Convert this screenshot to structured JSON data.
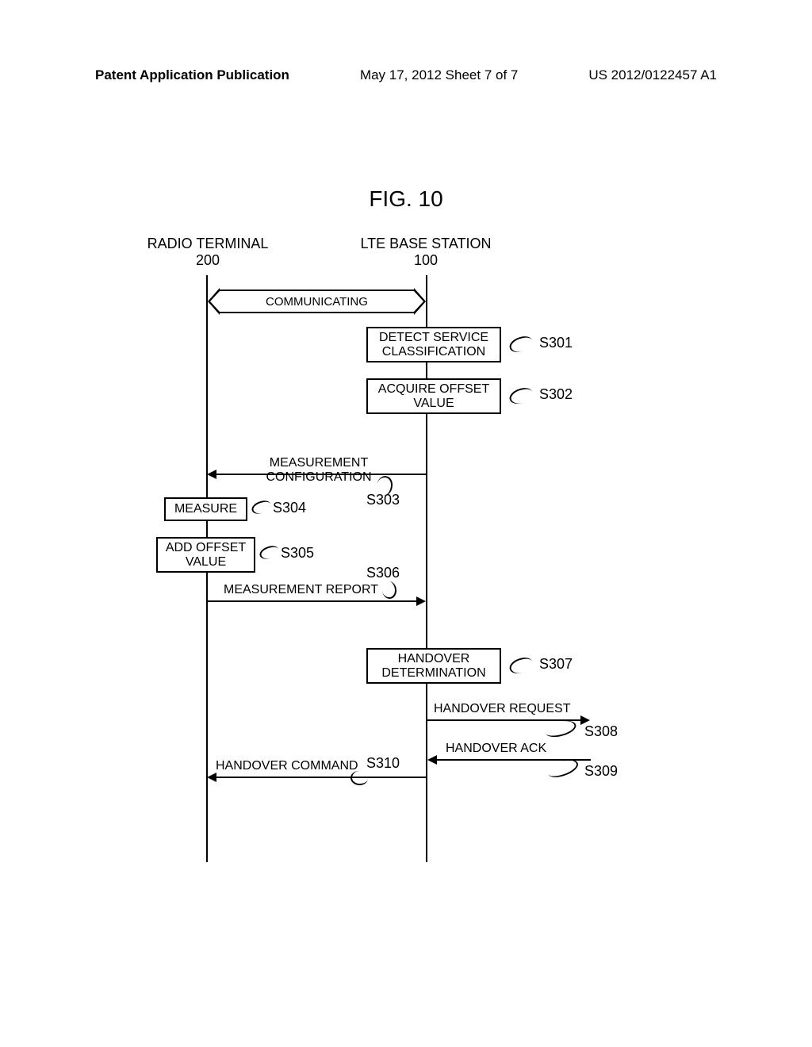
{
  "header": {
    "left": "Patent Application Publication",
    "center": "May 17, 2012  Sheet 7 of 7",
    "right": "US 2012/0122457 A1"
  },
  "figure_title": "FIG. 10",
  "entities": {
    "terminal": {
      "name": "RADIO TERMINAL",
      "id": "200"
    },
    "basestation": {
      "name": "LTE BASE STATION",
      "id": "100"
    }
  },
  "messages": {
    "communicating": "COMMUNICATING",
    "meas_config": "MEASUREMENT CONFIGURATION",
    "meas_report": "MEASUREMENT REPORT",
    "handover_req": "HANDOVER REQUEST",
    "handover_ack": "HANDOVER ACK",
    "handover_cmd": "HANDOVER COMMAND"
  },
  "boxes": {
    "detect": "DETECT SERVICE\nCLASSIFICATION",
    "acquire": "ACQUIRE OFFSET\nVALUE",
    "measure": "MEASURE",
    "add_offset": "ADD OFFSET\nVALUE",
    "handover_det": "HANDOVER\nDETERMINATION"
  },
  "steps": {
    "s301": "S301",
    "s302": "S302",
    "s303": "S303",
    "s304": "S304",
    "s305": "S305",
    "s306": "S306",
    "s307": "S307",
    "s308": "S308",
    "s309": "S309",
    "s310": "S310"
  }
}
